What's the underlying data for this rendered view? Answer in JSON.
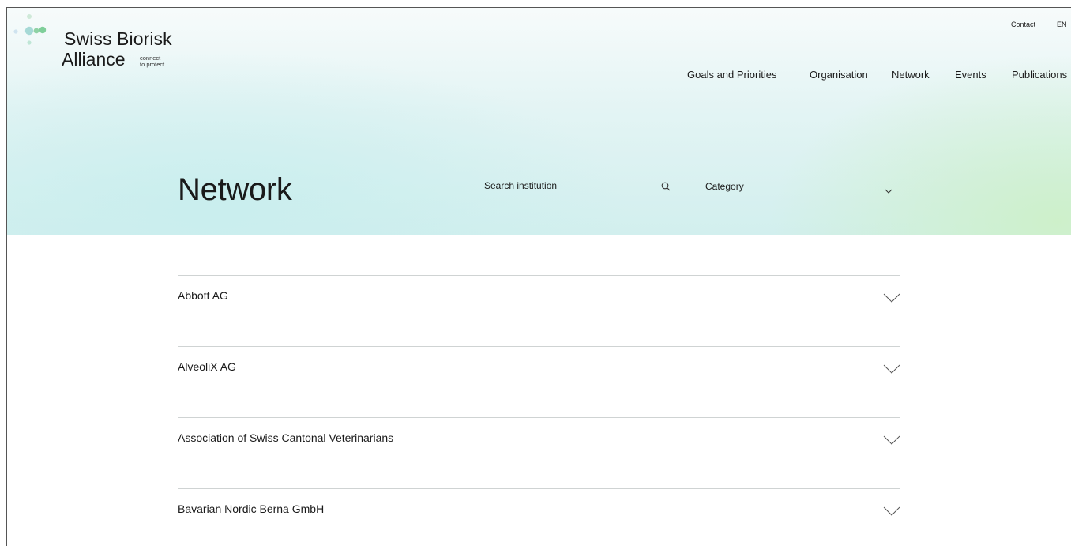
{
  "brand": {
    "name_line1": "Swiss Biorisk",
    "name_line2": "Alliance",
    "tagline_line1": "connect",
    "tagline_line2": "to protect",
    "colors": {
      "dot_green": "#7fcf9a",
      "dot_teal": "#a6d9d6"
    }
  },
  "utility": {
    "contact": "Contact",
    "language": "EN"
  },
  "nav": {
    "items": [
      {
        "label": "Goals and Priorities"
      },
      {
        "label": "Organisation"
      },
      {
        "label": "Network"
      },
      {
        "label": "Events"
      },
      {
        "label": "Publications"
      }
    ]
  },
  "page": {
    "title": "Network"
  },
  "filters": {
    "search_placeholder": "Search institution",
    "search_icon": "search-icon",
    "category_label": "Category",
    "category_icon": "chevron-down-icon"
  },
  "institutions": [
    {
      "name": "Abbott AG"
    },
    {
      "name": "AlveoliX AG"
    },
    {
      "name": "Association of Swiss Cantonal Veterinarians"
    },
    {
      "name": "Bavarian Nordic Berna GmbH"
    }
  ],
  "colors": {
    "hero_teal": "#d2efee",
    "hero_green": "#cdf0c8",
    "divider": "#cfd3d3",
    "text": "#1a1a1a"
  }
}
